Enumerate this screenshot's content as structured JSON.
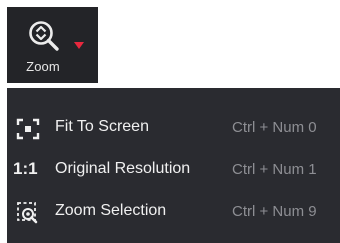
{
  "toolbar": {
    "zoom_label": "Zoom",
    "zoom_icon": "zoom-magnifier-icon",
    "dropdown_icon": "dropdown-arrow-icon",
    "accent_color": "#e8283e"
  },
  "menu": {
    "items": [
      {
        "label": "Fit To Screen",
        "shortcut": "Ctrl + Num 0",
        "icon": "fit-to-screen-icon"
      },
      {
        "label": "Original Resolution",
        "shortcut": "Ctrl + Num 1",
        "icon_text": "1:1"
      },
      {
        "label": "Zoom Selection",
        "shortcut": "Ctrl + Num 9",
        "icon": "zoom-selection-icon"
      }
    ]
  }
}
